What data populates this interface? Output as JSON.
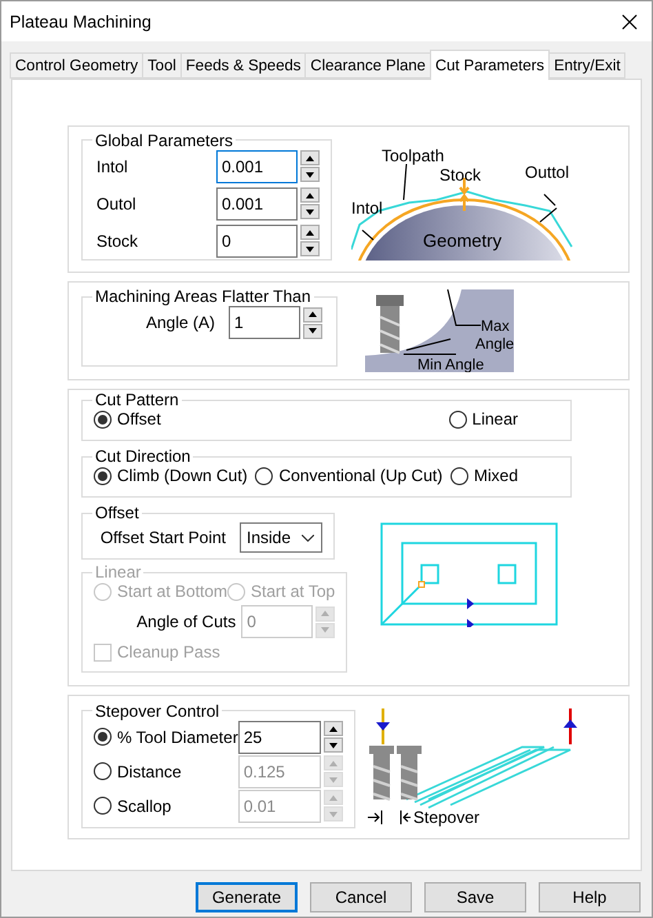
{
  "window": {
    "title": "Plateau Machining"
  },
  "tabs": [
    {
      "label": "Control Geometry",
      "selected": false
    },
    {
      "label": "Tool",
      "selected": false
    },
    {
      "label": "Feeds & Speeds",
      "selected": false
    },
    {
      "label": "Clearance Plane",
      "selected": false
    },
    {
      "label": "Cut Parameters",
      "selected": true
    },
    {
      "label": "Entry/Exit",
      "selected": false
    }
  ],
  "global_parameters": {
    "title": "Global Parameters",
    "fields": [
      {
        "label": "Intol",
        "value": "0.001",
        "focused": true
      },
      {
        "label": "Outol",
        "value": "0.001",
        "focused": false
      },
      {
        "label": "Stock",
        "value": "0",
        "focused": false
      }
    ],
    "diagram_labels": {
      "toolpath": "Toolpath",
      "stock": "Stock",
      "outtol": "Outtol",
      "intol": "Intol",
      "geometry": "Geometry"
    }
  },
  "flatter_than": {
    "title": "Machining Areas Flatter Than",
    "label": "Angle (A)",
    "value": "1",
    "diagram_labels": {
      "max": "Max",
      "angle": "Angle",
      "min": "Min Angle"
    }
  },
  "cut_pattern": {
    "title": "Cut Pattern",
    "options": [
      {
        "label": "Offset",
        "selected": true
      },
      {
        "label": "Linear",
        "selected": false
      }
    ]
  },
  "cut_direction": {
    "title": "Cut Direction",
    "options": [
      {
        "label": "Climb (Down Cut)",
        "selected": true
      },
      {
        "label": "Conventional (Up Cut)",
        "selected": false
      },
      {
        "label": "Mixed",
        "selected": false
      }
    ]
  },
  "offset": {
    "title": "Offset",
    "label": "Offset Start Point",
    "value": "Inside"
  },
  "linear": {
    "title": "Linear",
    "disabled": true,
    "options": [
      {
        "label": "Start at Bottom",
        "selected": false
      },
      {
        "label": "Start at Top",
        "selected": false
      }
    ],
    "angle_label": "Angle of Cuts",
    "angle_value": "0",
    "cleanup": {
      "label": "Cleanup Pass",
      "checked": false
    }
  },
  "stepover": {
    "title": "Stepover Control",
    "options": [
      {
        "label": "% Tool Diameter",
        "value": "25",
        "selected": true
      },
      {
        "label": "Distance",
        "value": "0.125",
        "selected": false
      },
      {
        "label": "Scallop",
        "value": "0.01",
        "selected": false
      }
    ],
    "diagram_label": "Stepover"
  },
  "buttons": [
    {
      "label": "Generate",
      "default": true
    },
    {
      "label": "Cancel",
      "default": false
    },
    {
      "label": "Save",
      "default": false
    },
    {
      "label": "Help",
      "default": false
    }
  ]
}
